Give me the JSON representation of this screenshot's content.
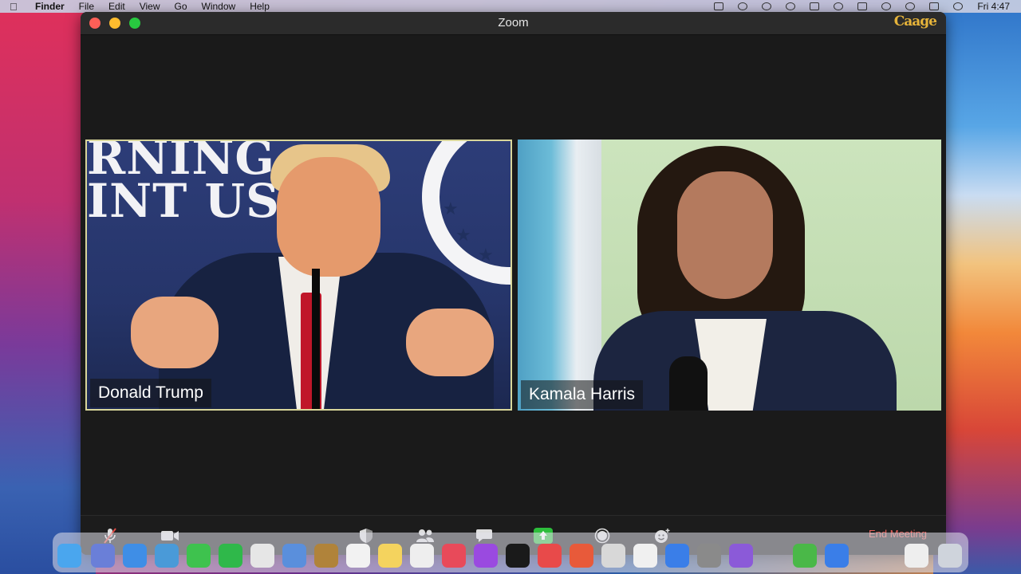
{
  "menubar": {
    "app": "Finder",
    "items": [
      "File",
      "Edit",
      "View",
      "Go",
      "Window",
      "Help"
    ],
    "clock": "Fri 4:47"
  },
  "window": {
    "title": "Zoom",
    "watermark": "Caage"
  },
  "participants": [
    {
      "name": "Donald Trump",
      "active_speaker": true
    },
    {
      "name": "Kamala Harris",
      "active_speaker": false
    }
  ],
  "toolbar": {
    "buttons": [
      "mute-icon",
      "video-icon",
      "security-icon",
      "participants-icon",
      "chat-icon",
      "share-screen-icon",
      "record-icon",
      "reactions-icon"
    ],
    "end_label": "End Meeting",
    "share_color": "#2dbe3c",
    "end_color": "#e8605a"
  }
}
